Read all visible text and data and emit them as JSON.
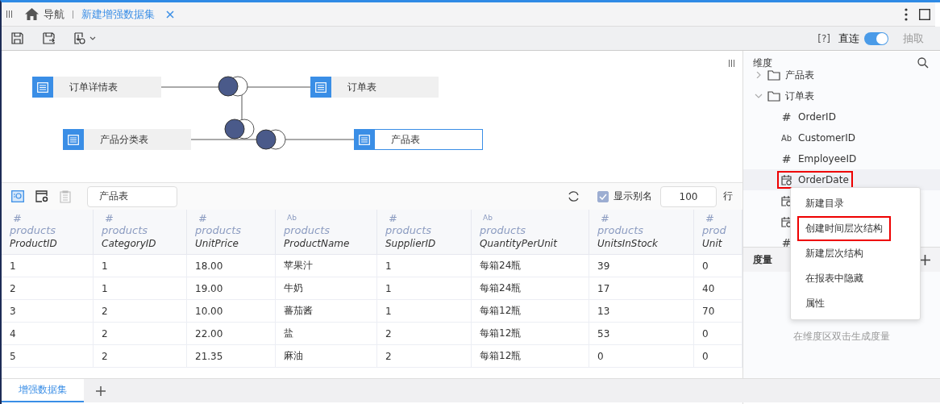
{
  "header": {
    "nav_label": "导航",
    "tabs": [
      {
        "label": "新建增强数据集",
        "selected": true
      }
    ]
  },
  "toolbar": {
    "help": "[?]",
    "mode_left": "直连",
    "mode_right": "抽取",
    "on": true
  },
  "diagram": {
    "nodes": [
      {
        "label": "订单详情表",
        "selected": false
      },
      {
        "label": "订单表",
        "selected": false
      },
      {
        "label": "产品分类表",
        "selected": false
      },
      {
        "label": "产品表",
        "selected": true
      }
    ]
  },
  "table_toolbar": {
    "table_name": "产品表",
    "show_alias": {
      "label": "显示别名",
      "checked": true
    },
    "row_limit": "100",
    "rows_unit": "行"
  },
  "table": {
    "columns": [
      {
        "kind": "number",
        "icon": "#",
        "group": "products",
        "name": "ProductID"
      },
      {
        "kind": "number",
        "icon": "#",
        "group": "products",
        "name": "CategoryID"
      },
      {
        "kind": "number",
        "icon": "#",
        "group": "products",
        "name": "UnitPrice"
      },
      {
        "kind": "text",
        "icon": "Ab",
        "group": "products",
        "name": "ProductName"
      },
      {
        "kind": "number",
        "icon": "#",
        "group": "products",
        "name": "SupplierID"
      },
      {
        "kind": "text",
        "icon": "Ab",
        "group": "products",
        "name": "QuantityPerUnit"
      },
      {
        "kind": "number",
        "icon": "#",
        "group": "products",
        "name": "UnitsInStock"
      },
      {
        "kind": "number",
        "icon": "#",
        "group": "prod",
        "name": "Unit"
      }
    ],
    "rows": [
      [
        "1",
        "1",
        "18.00",
        "苹果汁",
        "1",
        "每箱24瓶",
        "39",
        "0"
      ],
      [
        "2",
        "1",
        "19.00",
        "牛奶",
        "1",
        "每箱24瓶",
        "17",
        "40"
      ],
      [
        "3",
        "2",
        "10.00",
        "蕃茄酱",
        "1",
        "每箱12瓶",
        "13",
        "70"
      ],
      [
        "4",
        "2",
        "22.00",
        "盐",
        "2",
        "每箱12瓶",
        "53",
        "0"
      ],
      [
        "5",
        "2",
        "21.35",
        "麻油",
        "2",
        "每箱12瓶",
        "0",
        "0"
      ]
    ]
  },
  "bottom_tabs": [
    {
      "label": "增强数据集",
      "selected": true
    }
  ],
  "panel": {
    "dimension_title": "维度",
    "tree": [
      {
        "label": "产品表",
        "expanded": false
      },
      {
        "label": "订单表",
        "expanded": true,
        "children": [
          {
            "kind": "number",
            "icon": "#",
            "label": "OrderID",
            "selected": false
          },
          {
            "kind": "text",
            "icon": "Ab",
            "label": "CustomerID",
            "selected": false
          },
          {
            "kind": "number",
            "icon": "#",
            "label": "EmployeeID",
            "selected": false
          },
          {
            "kind": "date",
            "label": "OrderDate",
            "selected": true
          },
          {
            "kind": "date",
            "selected": false
          },
          {
            "kind": "date",
            "selected": false
          },
          {
            "kind": "number",
            "icon": "#",
            "selected": false
          }
        ]
      }
    ],
    "measure_title": "度量",
    "measure_hint": "在维度区双击生成度量"
  },
  "context_menu": {
    "items": [
      {
        "label": "新建目录",
        "selected": false
      },
      {
        "label": "创建时间层次结构",
        "selected": true
      },
      {
        "label": "新建层次结构",
        "selected": false
      },
      {
        "label": "在报表中隐藏",
        "selected": false
      },
      {
        "label": "属性",
        "selected": false
      }
    ]
  }
}
